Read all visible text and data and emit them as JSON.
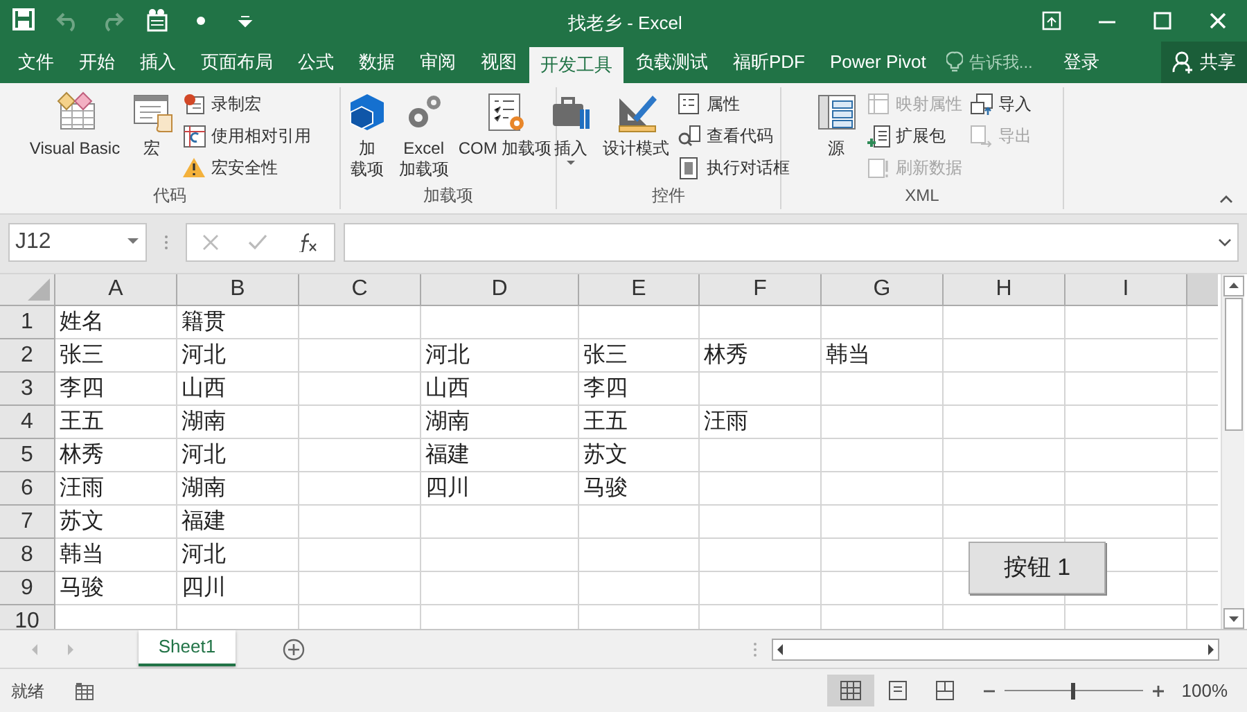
{
  "title_bar": {
    "title": "找老乡 - Excel",
    "quick_access": [
      {
        "kind": "save",
        "disabled": false
      },
      {
        "kind": "undo",
        "disabled": true
      },
      {
        "kind": "redo",
        "disabled": true
      },
      {
        "kind": "form",
        "disabled": false
      },
      {
        "kind": "dot",
        "disabled": false
      },
      {
        "kind": "customize",
        "disabled": false
      }
    ]
  },
  "tabs": [
    {
      "label": "文件",
      "selected": false
    },
    {
      "label": "开始",
      "selected": false
    },
    {
      "label": "插入",
      "selected": false
    },
    {
      "label": "页面布局",
      "selected": false
    },
    {
      "label": "公式",
      "selected": false
    },
    {
      "label": "数据",
      "selected": false
    },
    {
      "label": "审阅",
      "selected": false
    },
    {
      "label": "视图",
      "selected": false
    },
    {
      "label": "开发工具",
      "selected": true
    },
    {
      "label": "负载测试",
      "selected": false
    },
    {
      "label": "福昕PDF",
      "selected": false
    },
    {
      "label": "Power Pivot",
      "selected": false
    }
  ],
  "tell_me": {
    "placeholder": "告诉我..."
  },
  "sign_in": "登录",
  "share": "共享",
  "ribbon_groups": [
    {
      "label": "代码",
      "columns": [
        {
          "kind": "large",
          "lines": [
            "Visual Basic"
          ],
          "disabled": false
        },
        {
          "kind": "large",
          "lines": [
            "宏"
          ],
          "disabled": false
        },
        {
          "kind": "stack",
          "items": [
            {
              "label": "录制宏",
              "disabled": false
            },
            {
              "label": "使用相对引用",
              "disabled": false
            },
            {
              "label": "宏安全性",
              "disabled": false
            }
          ]
        }
      ]
    },
    {
      "label": "加载项",
      "columns": [
        {
          "kind": "large",
          "lines": [
            "加",
            "载项"
          ],
          "disabled": false
        },
        {
          "kind": "large",
          "lines": [
            "Excel",
            "加载项"
          ],
          "disabled": false
        },
        {
          "kind": "large",
          "lines": [
            "COM 加载项"
          ],
          "disabled": false
        }
      ]
    },
    {
      "label": "控件",
      "columns": [
        {
          "kind": "large",
          "lines": [
            "插入"
          ],
          "dropdown": true,
          "disabled": false
        },
        {
          "kind": "large",
          "lines": [
            "设计模式"
          ],
          "disabled": false
        },
        {
          "kind": "stack",
          "items": [
            {
              "label": "属性",
              "disabled": false
            },
            {
              "label": "查看代码",
              "disabled": false
            },
            {
              "label": "执行对话框",
              "disabled": false
            }
          ]
        }
      ]
    },
    {
      "label": "XML",
      "columns": [
        {
          "kind": "large",
          "lines": [
            "源"
          ],
          "disabled": false
        },
        {
          "kind": "stack",
          "items": [
            {
              "label": "映射属性",
              "disabled": true
            },
            {
              "label": "扩展包",
              "disabled": false
            },
            {
              "label": "刷新数据",
              "disabled": true
            }
          ]
        },
        {
          "kind": "stack",
          "items": [
            {
              "label": "导入",
              "disabled": false
            },
            {
              "label": "导出",
              "disabled": true
            }
          ]
        }
      ]
    }
  ],
  "name_box": "J12",
  "sheet": {
    "columns": [
      "A",
      "B",
      "C",
      "D",
      "E",
      "F",
      "G",
      "H",
      "I"
    ],
    "rows": [
      {
        "number": "1",
        "cells": {
          "A": "姓名",
          "B": "籍贯"
        }
      },
      {
        "number": "2",
        "cells": {
          "A": "张三",
          "B": "河北",
          "D": "河北",
          "E": "张三",
          "F": "林秀",
          "G": "韩当"
        }
      },
      {
        "number": "3",
        "cells": {
          "A": "李四",
          "B": "山西",
          "D": "山西",
          "E": "李四"
        }
      },
      {
        "number": "4",
        "cells": {
          "A": "王五",
          "B": "湖南",
          "D": "湖南",
          "E": "王五",
          "F": "汪雨"
        }
      },
      {
        "number": "5",
        "cells": {
          "A": "林秀",
          "B": "河北",
          "D": "福建",
          "E": "苏文"
        }
      },
      {
        "number": "6",
        "cells": {
          "A": "汪雨",
          "B": "湖南",
          "D": "四川",
          "E": "马骏"
        }
      },
      {
        "number": "7",
        "cells": {
          "A": "苏文",
          "B": "福建"
        }
      },
      {
        "number": "8",
        "cells": {
          "A": "韩当",
          "B": "河北"
        }
      },
      {
        "number": "9",
        "cells": {
          "A": "马骏",
          "B": "四川"
        }
      },
      {
        "number": "10",
        "cells": {}
      }
    ],
    "button": "按钮 1"
  },
  "sheet_tabs": [
    {
      "label": "Sheet1",
      "selected": true
    }
  ],
  "status_bar": {
    "status": "就绪",
    "zoom": "100%",
    "zoom_level": {
      "level": 0.5
    }
  }
}
